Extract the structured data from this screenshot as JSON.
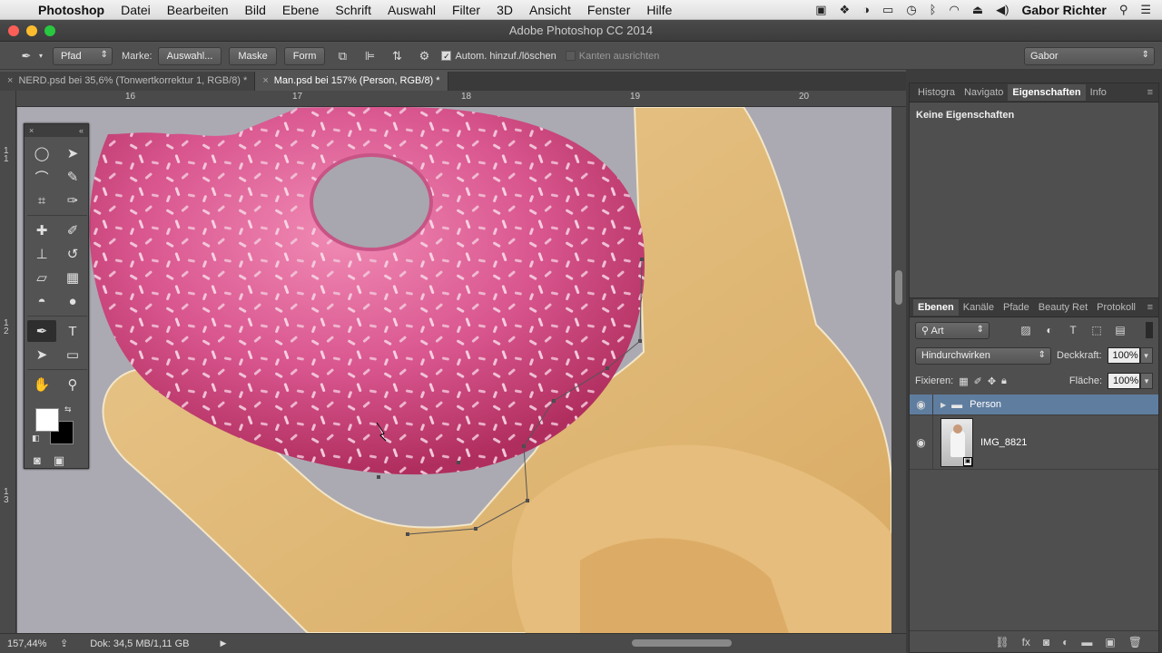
{
  "menubar": {
    "app_name": "Photoshop",
    "items": [
      "Datei",
      "Bearbeiten",
      "Bild",
      "Ebene",
      "Schrift",
      "Auswahl",
      "Filter",
      "3D",
      "Ansicht",
      "Fenster",
      "Hilfe"
    ],
    "user": "Gabor Richter"
  },
  "window": {
    "title": "Adobe Photoshop CC 2014"
  },
  "options": {
    "mode_select": "Pfad",
    "make_label": "Marke:",
    "selection_button": "Auswahl...",
    "mask_button": "Maske",
    "shape_button": "Form",
    "auto_add_delete": "Autom. hinzuf./löschen",
    "align_edges": "Kanten ausrichten",
    "workspace": "Gabor"
  },
  "tabs": [
    {
      "label": "NERD.psd bei 35,6% (Tonwertkorrektur 1, RGB/8) *"
    },
    {
      "label": "Man.psd bei 157% (Person, RGB/8) *"
    }
  ],
  "ruler": {
    "top_labels": [
      "16",
      "17",
      "18",
      "19",
      "20"
    ],
    "left_labels": [
      "1\n1",
      "1\n2",
      "1\n3"
    ]
  },
  "status": {
    "zoom": "157,44%",
    "doc_size": "Dok: 34,5 MB/1,11 GB"
  },
  "properties_panel": {
    "tabs": [
      "Histogra",
      "Navigato",
      "Eigenschaften",
      "Info"
    ],
    "content": "Keine Eigenschaften"
  },
  "layers_panel": {
    "tabs": [
      "Ebenen",
      "Kanäle",
      "Pfade",
      "Beauty Ret",
      "Protokoll"
    ],
    "filter_select": "Art",
    "blend_mode": "Hindurchwirken",
    "opacity_label": "Deckkraft:",
    "opacity_value": "100%",
    "lock_label": "Fixieren:",
    "fill_label": "Fläche:",
    "fill_value": "100%",
    "layers": [
      {
        "name": "Person",
        "type": "group",
        "selected": true
      },
      {
        "name": "IMG_8821",
        "type": "smart-object",
        "selected": false
      }
    ]
  },
  "colors": {
    "accent_selected": "#5f7d9f",
    "foreground": "#ffffff",
    "background": "#000000",
    "donut_pink": "#d14f86",
    "skin": "#e7c58d"
  }
}
